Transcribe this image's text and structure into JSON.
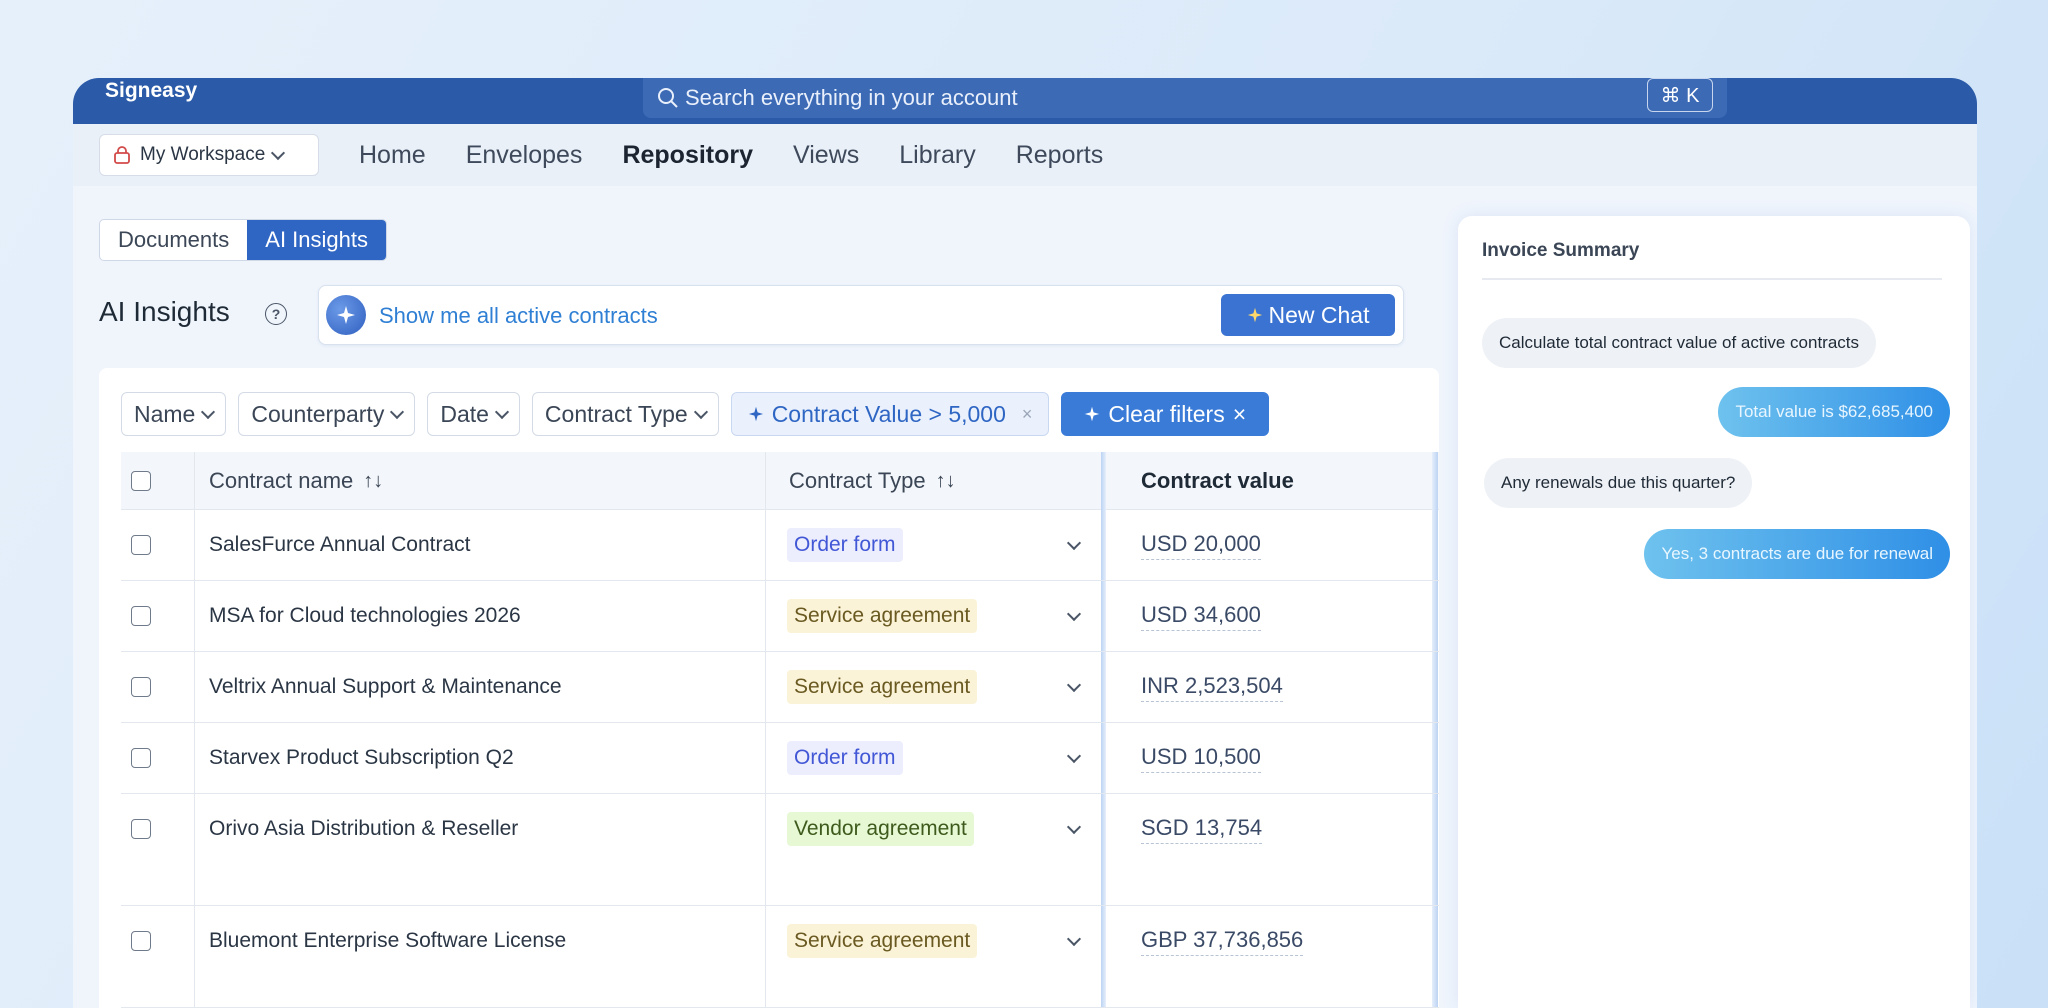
{
  "app": {
    "brand": "Signeasy"
  },
  "search": {
    "placeholder": "Search everything in your account",
    "shortcut": "⌘ K"
  },
  "workspace": {
    "label": "My Workspace"
  },
  "nav": {
    "items": [
      "Home",
      "Envelopes",
      "Repository",
      "Views",
      "Library",
      "Reports"
    ],
    "active": "Repository"
  },
  "segment": {
    "documents": "Documents",
    "ai_insights": "AI Insights",
    "active": "AI Insights"
  },
  "ai": {
    "title": "AI Insights",
    "help": "?",
    "prompt": "Show me all active contracts",
    "new_chat": "New Chat"
  },
  "filters": {
    "name": "Name",
    "counterparty": "Counterparty",
    "date": "Date",
    "contract_type": "Contract Type",
    "ai_filter": "Contract Value > 5,000",
    "ai_filter_remove": "×",
    "clear": "Clear filters",
    "clear_icon": "×"
  },
  "table": {
    "headers": {
      "name": "Contract name",
      "type": "Contract Type",
      "value": "Contract value",
      "sort_icon": "↑↓"
    },
    "rows": [
      {
        "name": "SalesFurce Annual Contract",
        "type": "Order form",
        "kind": "order",
        "value": "USD 20,000"
      },
      {
        "name": "MSA for Cloud technologies 2026",
        "type": "Service agreement",
        "kind": "service",
        "value": "USD 34,600"
      },
      {
        "name": "Veltrix Annual Support & Maintenance",
        "type": "Service agreement",
        "kind": "service",
        "value": "INR 2,523,504"
      },
      {
        "name": "Starvex Product Subscription Q2",
        "type": "Order form",
        "kind": "order",
        "value": "USD 10,500"
      },
      {
        "name": "Orivo Asia Distribution & Reseller",
        "type": "Vendor agreement",
        "kind": "vendor",
        "value": "SGD 13,754"
      },
      {
        "name": "Bluemont Enterprise Software License",
        "type": "Service agreement",
        "kind": "service",
        "value": "GBP 37,736,856"
      }
    ]
  },
  "panel": {
    "title": "Invoice Summary",
    "messages": [
      {
        "role": "user",
        "text": "Calculate total contract value of active contracts"
      },
      {
        "role": "ai",
        "text": "Total value is $62,685,400"
      },
      {
        "role": "user",
        "text": "Any renewals due this quarter?"
      },
      {
        "role": "ai",
        "text": "Yes, 3 contracts are due for renewal"
      }
    ]
  },
  "colors": {
    "brand": "#2a5aa8",
    "accent": "#3a73d1",
    "ai_text": "#2f7fd4"
  }
}
